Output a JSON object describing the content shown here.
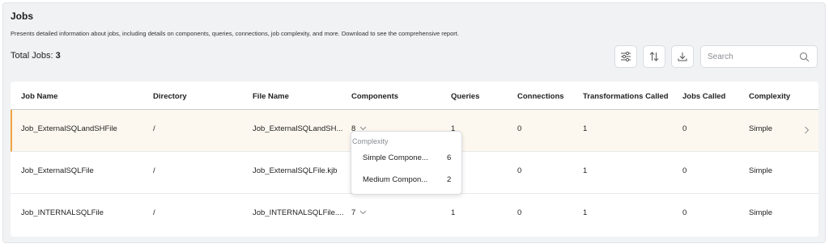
{
  "header": {
    "title": "Jobs",
    "description": "Presents detailed information about jobs, including details on components, queries, connections, job complexity, and more. Download to see the comprehensive report.",
    "total_label": "Total Jobs:",
    "total_value": "3"
  },
  "toolbar": {
    "filter_icon": "sliders-icon",
    "sort_icon": "sort-icon",
    "download_icon": "download-icon",
    "search_placeholder": "Search",
    "search_icon": "search-icon"
  },
  "table": {
    "columns": [
      "Job Name",
      "Directory",
      "File Name",
      "Components",
      "Queries",
      "Connections",
      "Transformations Called",
      "Jobs Called",
      "Complexity"
    ],
    "rows": [
      {
        "job_name": "Job_ExternalSQLandSHFile",
        "directory": "/",
        "file_name": "Job_ExternalSQLandSH...",
        "components": "8",
        "queries": "1",
        "connections": "0",
        "transformations": "1",
        "jobs_called": "0",
        "complexity": "Simple"
      },
      {
        "job_name": "Job_ExternalSQLFile",
        "directory": "/",
        "file_name": "Job_ExternalSQLFile.kjb",
        "components": "",
        "queries": "",
        "connections": "0",
        "transformations": "1",
        "jobs_called": "0",
        "complexity": "Simple"
      },
      {
        "job_name": "Job_INTERNALSQLFile",
        "directory": "/",
        "file_name": "Job_INTERNALSQLFile....",
        "components": "7",
        "queries": "1",
        "connections": "0",
        "transformations": "1",
        "jobs_called": "0",
        "complexity": "Simple"
      }
    ],
    "selected_row_accent": "#f0a640",
    "selected_row_bg": "#fdf8ef"
  },
  "popover": {
    "title": "Complexity",
    "items": [
      {
        "label": "Simple Compone...",
        "count": "6"
      },
      {
        "label": "Medium Compon...",
        "count": "2"
      }
    ]
  }
}
